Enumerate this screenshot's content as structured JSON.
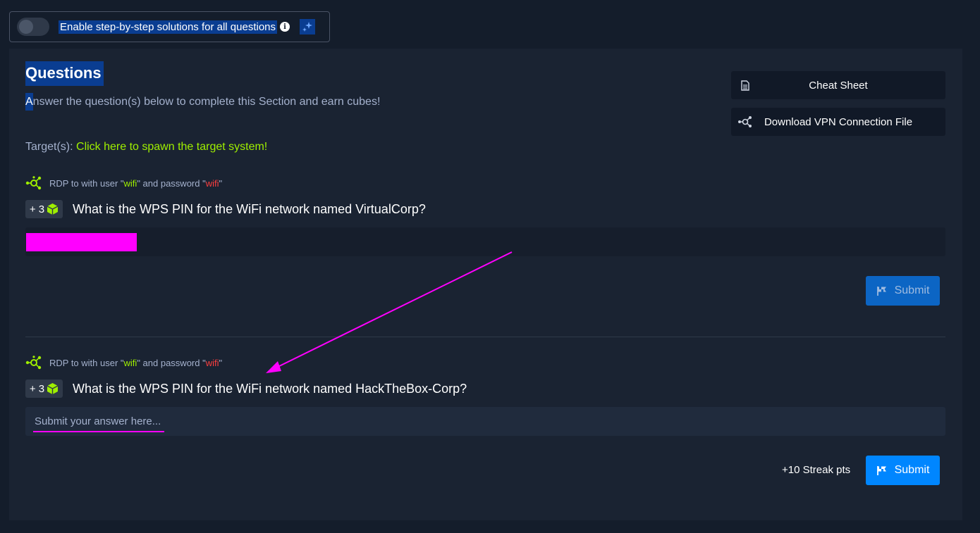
{
  "toggle": {
    "label": "Enable step-by-step solutions for all questions",
    "info": "i",
    "enabled": false
  },
  "section": {
    "title": "Questions",
    "subtitle_first": "A",
    "subtitle_rest": "nswer the question(s) below to complete this Section and earn cubes!",
    "targets_label": "Target(s): ",
    "targets_link": "Click here to spawn the target system!"
  },
  "side_buttons": {
    "cheat_sheet": "Cheat Sheet",
    "vpn": "Download VPN Connection File"
  },
  "questions": [
    {
      "hint_prefix": "RDP to with user \"",
      "hint_user": "wifi",
      "hint_middle": "\" and password \"",
      "hint_password": "wifi",
      "hint_suffix": "\"",
      "points": "+ 3",
      "text": "What is the WPS PIN for the WiFi network named VirtualCorp?",
      "submit": "Submit"
    },
    {
      "hint_prefix": "RDP to with user \"",
      "hint_user": "wifi",
      "hint_middle": "\" and password \"",
      "hint_password": "wifi",
      "hint_suffix": "\"",
      "points": "+ 3",
      "text": "What is the WPS PIN for the WiFi network named HackTheBox-Corp?",
      "placeholder": "Submit your answer here...",
      "submit": "Submit",
      "streak": "+10 Streak pts"
    }
  ],
  "colors": {
    "accent_green": "#9fef00",
    "accent_red": "#ff3e3e",
    "primary_blue": "#0086ff",
    "annotation_magenta": "#ff00ff"
  },
  "icons": [
    "info-icon",
    "sparkle-icon",
    "document-icon",
    "network-icon",
    "hub-icon",
    "cube-icon",
    "flag-icon"
  ]
}
